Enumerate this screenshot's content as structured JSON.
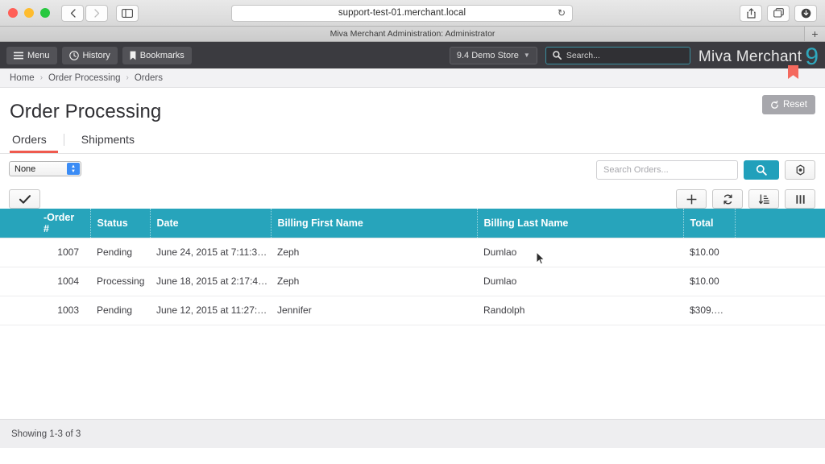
{
  "browser": {
    "url": "support-test-01.merchant.local",
    "tab_title": "Miva Merchant Administration: Administrator",
    "back_icon": "chevron-left-icon",
    "forward_icon": "chevron-right-icon",
    "sidebar_icon": "sidebar-toggle-icon",
    "reload_icon": "reload-icon",
    "share_icon": "share-icon",
    "tabs_icon": "tab-overview-icon",
    "download_icon": "download-icon",
    "newtab_label": "+"
  },
  "topbar": {
    "menu_label": "Menu",
    "history_label": "History",
    "bookmarks_label": "Bookmarks",
    "store_label": "9.4 Demo Store",
    "search_placeholder": "Search...",
    "logo_text": "Miva Merchant",
    "logo_version": "9"
  },
  "breadcrumb": {
    "items": [
      "Home",
      "Order Processing",
      "Orders"
    ],
    "separator": "›"
  },
  "page": {
    "title": "Order Processing",
    "tabs": [
      {
        "label": "Orders",
        "active": true
      },
      {
        "label": "Shipments",
        "active": false
      }
    ],
    "reset_label": "Reset"
  },
  "toolbar": {
    "batch_select_value": "None",
    "apply_label": "✔",
    "search_placeholder": "Search Orders...",
    "search_button_icon": "search-icon",
    "settings_icon": "settings-icon",
    "add_icon": "plus-icon",
    "refresh_icon": "refresh-icon",
    "sort_icon": "sort-icon",
    "columns_icon": "columns-icon"
  },
  "table": {
    "columns": [
      "-Order #",
      "Status",
      "Date",
      "Billing First Name",
      "Billing Last Name",
      "Total"
    ],
    "rows": [
      {
        "order": "1007",
        "status": "Pending",
        "date": "June 24, 2015 at 7:11:3…",
        "first_name": "Zeph",
        "last_name": "Dumlao",
        "total": "$10.00"
      },
      {
        "order": "1004",
        "status": "Processing",
        "date": "June 18, 2015 at 2:17:4…",
        "first_name": "Zeph",
        "last_name": "Dumlao",
        "total": "$10.00"
      },
      {
        "order": "1003",
        "status": "Pending",
        "date": "June 12, 2015 at 11:27:…",
        "first_name": "Jennifer",
        "last_name": "Randolph",
        "total": "$309.…"
      }
    ]
  },
  "footer": {
    "showing_text": "Showing 1-3 of 3"
  },
  "colors": {
    "accent_teal": "#27a4bb",
    "tab_underline_red": "#ef5a4e",
    "topbar_dark": "#3b3b40",
    "ribbon_red": "#f4695e"
  }
}
